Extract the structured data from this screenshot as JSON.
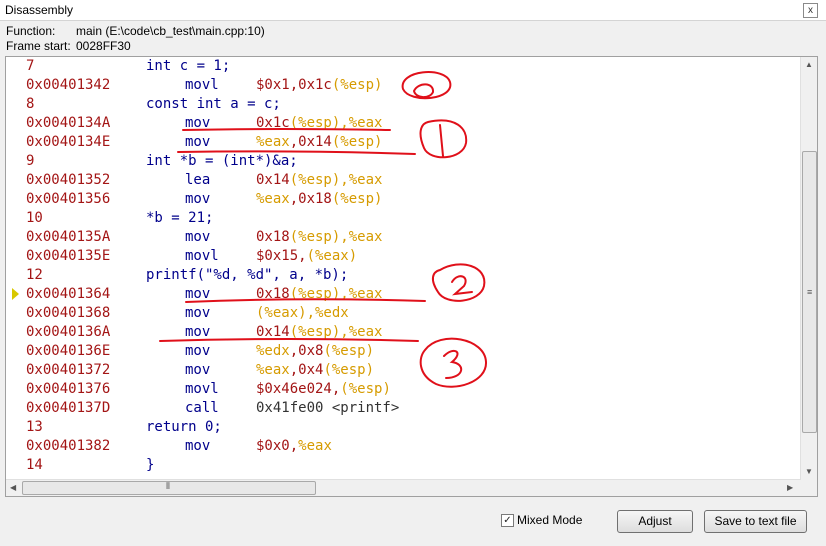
{
  "window": {
    "title": "Disassembly",
    "close_glyph": "x"
  },
  "info": {
    "function_label": "Function:",
    "function_value": "main (E:\\code\\cb_test\\main.cpp:10)",
    "frame_label": "Frame start:",
    "frame_value": "0028FF30"
  },
  "lines": [
    {
      "addr": "7",
      "src": "int c = 1;"
    },
    {
      "addr": "0x00401342",
      "mnemonic": "movl",
      "operands": [
        [
          "n",
          "$0x1,0x1c"
        ],
        [
          "r",
          "(%esp)"
        ]
      ]
    },
    {
      "addr": "8",
      "src": "const int a = c;"
    },
    {
      "addr": "0x0040134A",
      "mnemonic": "mov",
      "operands": [
        [
          "n",
          "0x1c"
        ],
        [
          "r",
          "(%esp),%eax"
        ]
      ]
    },
    {
      "addr": "0x0040134E",
      "mnemonic": "mov",
      "operands": [
        [
          "r",
          "%eax"
        ],
        [
          "n",
          ",0x14"
        ],
        [
          "r",
          "(%esp)"
        ]
      ]
    },
    {
      "addr": "9",
      "src": "int *b = (int*)&a;"
    },
    {
      "addr": "0x00401352",
      "mnemonic": "lea",
      "operands": [
        [
          "n",
          "0x14"
        ],
        [
          "r",
          "(%esp),%eax"
        ]
      ]
    },
    {
      "addr": "0x00401356",
      "mnemonic": "mov",
      "operands": [
        [
          "r",
          "%eax"
        ],
        [
          "n",
          ",0x18"
        ],
        [
          "r",
          "(%esp)"
        ]
      ]
    },
    {
      "addr": "10",
      "src": "*b = 21;"
    },
    {
      "addr": "0x0040135A",
      "mnemonic": "mov",
      "operands": [
        [
          "n",
          "0x18"
        ],
        [
          "r",
          "(%esp),%eax"
        ]
      ]
    },
    {
      "addr": "0x0040135E",
      "mnemonic": "movl",
      "operands": [
        [
          "n",
          "$0x15,"
        ],
        [
          "r",
          "(%eax)"
        ]
      ]
    },
    {
      "addr": "12",
      "src": "printf(\"%d, %d\", a, *b);"
    },
    {
      "addr": "0x00401364",
      "mnemonic": "mov",
      "operands": [
        [
          "n",
          "0x18"
        ],
        [
          "r",
          "(%esp),%eax"
        ]
      ],
      "current": true
    },
    {
      "addr": "0x00401368",
      "mnemonic": "mov",
      "operands": [
        [
          "r",
          "(%eax),%edx"
        ]
      ]
    },
    {
      "addr": "0x0040136A",
      "mnemonic": "mov",
      "operands": [
        [
          "n",
          "0x14"
        ],
        [
          "r",
          "(%esp),%eax"
        ]
      ]
    },
    {
      "addr": "0x0040136E",
      "mnemonic": "mov",
      "operands": [
        [
          "r",
          "%edx"
        ],
        [
          "n",
          ",0x8"
        ],
        [
          "r",
          "(%esp)"
        ]
      ]
    },
    {
      "addr": "0x00401372",
      "mnemonic": "mov",
      "operands": [
        [
          "r",
          "%eax"
        ],
        [
          "n",
          ",0x4"
        ],
        [
          "r",
          "(%esp)"
        ]
      ]
    },
    {
      "addr": "0x00401376",
      "mnemonic": "movl",
      "operands": [
        [
          "n",
          "$0x46e024,"
        ],
        [
          "r",
          "(%esp)"
        ]
      ]
    },
    {
      "addr": "0x0040137D",
      "mnemonic": "call",
      "operands": [
        [
          "p",
          "0x41fe00 <printf>"
        ]
      ]
    },
    {
      "addr": "13",
      "src": "return 0;"
    },
    {
      "addr": "0x00401382",
      "mnemonic": "mov",
      "operands": [
        [
          "n",
          "$0x0,"
        ],
        [
          "r",
          "%eax"
        ]
      ]
    },
    {
      "addr": "14",
      "src": "}"
    }
  ],
  "footer": {
    "mixed_mode_label": "Mixed Mode",
    "mixed_mode_checked": true,
    "adjust_label": "Adjust",
    "save_label": "Save to text file"
  },
  "annotation_color": "#e0101a"
}
